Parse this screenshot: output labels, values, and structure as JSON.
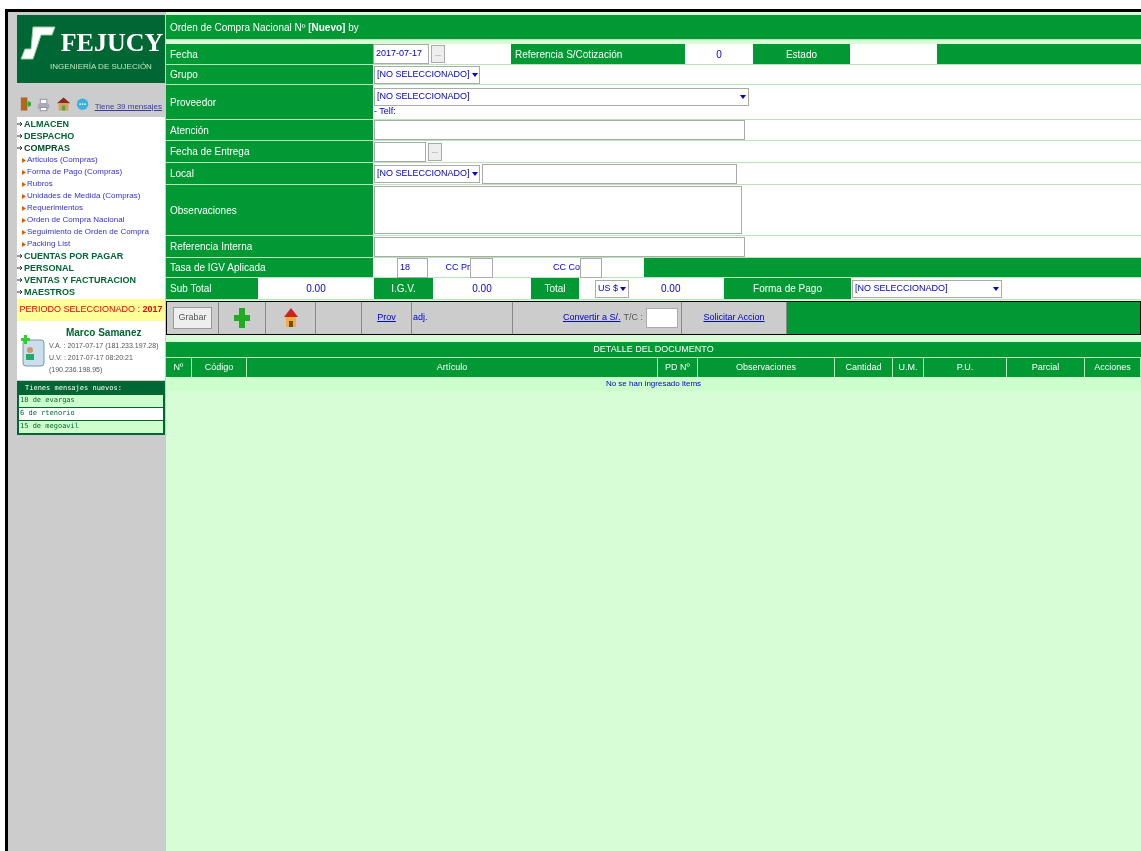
{
  "sidebar": {
    "logo": {
      "name": "FEJUCY",
      "tagline": "INGENIERÍA DE SUJECIÓN"
    },
    "messages_link": "Tiene 39 mensajes",
    "menu": [
      {
        "label": "ALMACEN",
        "expanded": false
      },
      {
        "label": "DESPACHO",
        "expanded": false
      },
      {
        "label": "COMPRAS",
        "expanded": true,
        "children": [
          "Articulos (Compras)",
          "Forma de Pago (Compras)",
          "Rubros",
          "Unidades de Medida (Compras)",
          "Requerimientos",
          "Orden de Compra Nacional",
          "Seguimiento de Orden de Compra",
          "Packing List"
        ]
      },
      {
        "label": "CUENTAS POR PAGAR",
        "expanded": false
      },
      {
        "label": "PERSONAL",
        "expanded": false
      },
      {
        "label": "VENTAS Y FACTURACION",
        "expanded": false
      },
      {
        "label": "MAESTROS",
        "expanded": false
      }
    ],
    "period": "PERIODO SELECCIONADO : **2017**",
    "user": {
      "name": "Marco Samanez",
      "lines": [
        "V.A. : 2017-07-17 (181.233.197.28)",
        "U.V. : 2017-07-17 08:20:21",
        "(190.236.198.95)"
      ]
    },
    "new_messages": {
      "title": "Tienes mensajes nuevos:",
      "items": [
        {
          "text": "18 de evargas",
          "highlighted": true
        },
        {
          "text": "6 de rtenorio",
          "highlighted": false
        },
        {
          "text": "15 de megoavil",
          "highlighted": true
        }
      ]
    }
  },
  "form": {
    "title": "Orden de Compra Nacional Nº **[Nuevo]** by",
    "fecha": {
      "label": "Fecha",
      "value": "2017-07-17",
      "picker": "..."
    },
    "referencia": {
      "label": "Referencia S/Cotización",
      "value": "0"
    },
    "estado": {
      "label": "Estado"
    },
    "grupo": {
      "label": "Grupo",
      "value": "[NO SELECCIONADO]"
    },
    "proveedor": {
      "label": "Proveedor",
      "value": "[NO SELECCIONADO]",
      "phone": "- Telf:"
    },
    "atencion": {
      "label": "Atención"
    },
    "fecha_entrega": {
      "label": "Fecha de Entrega",
      "picker": "..."
    },
    "local": {
      "label": "Local",
      "value": "[NO SELECCIONADO]"
    },
    "observaciones": {
      "label": "Observaciones"
    },
    "referencia_interna": {
      "label": "Referencia Interna"
    },
    "igv_rate": {
      "label": "Tasa de IGV Aplicada",
      "value": "18",
      "cc_pr": "CC Pr",
      "cc_co": "CC Co"
    },
    "totals": {
      "subtotal_label": "Sub Total",
      "subtotal": "0.00",
      "igv_label": "I.G.V.",
      "igv": "0.00",
      "total_label": "Total",
      "currency": "US $",
      "total": "0.00",
      "payment_label": "Forma de Pago",
      "payment_value": "[NO SELECCIONADO]"
    }
  },
  "actions": {
    "save": "Grabar",
    "prov": "Prov",
    "adj": "adj.",
    "convert": "Convertir a S/.",
    "tc": "T/C :",
    "request": "Solicitar Accion"
  },
  "detail": {
    "title": "DETALLE DEL DOCUMENTO",
    "columns": [
      "Nº",
      "Código",
      "Artículo",
      "PD Nº",
      "Observaciones",
      "Cantidad",
      "U.M.",
      "P.U.",
      "Parcial",
      "Acciones"
    ],
    "empty": "No se han ingresado items"
  }
}
